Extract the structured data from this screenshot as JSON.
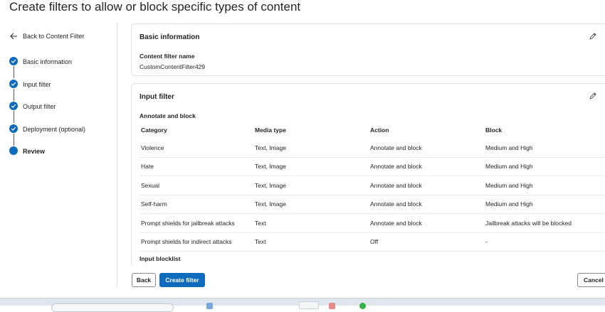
{
  "page": {
    "title": "Create filters to allow or block specific types of content"
  },
  "nav": {
    "back_label": "Back to Content Filter",
    "steps": [
      {
        "label": "Basic information",
        "status": "complete"
      },
      {
        "label": "Input filter",
        "status": "complete"
      },
      {
        "label": "Output filter",
        "status": "complete"
      },
      {
        "label": "Deployment (optional)",
        "status": "complete"
      },
      {
        "label": "Review",
        "status": "current"
      }
    ]
  },
  "basic": {
    "title": "Basic information",
    "field_label": "Content filter name",
    "field_value": "CustomContentFilter429"
  },
  "input_filter": {
    "title": "Input filter",
    "annotate_label": "Annotate and block",
    "columns": [
      "Category",
      "Media type",
      "Action",
      "Block"
    ],
    "rows": [
      [
        "Violence",
        "Text, Image",
        "Annotate and block",
        "Medium and High"
      ],
      [
        "Hate",
        "Text, Image",
        "Annotate and block",
        "Medium and High"
      ],
      [
        "Sexual",
        "Text, Image",
        "Annotate and block",
        "Medium and High"
      ],
      [
        "Self-harm",
        "Text, Image",
        "Annotate and block",
        "Medium and High"
      ],
      [
        "Prompt shields for jailbreak attacks",
        "Text",
        "Annotate and block",
        "Jailbreak attacks will be blocked"
      ],
      [
        "Prompt shields for indirect attacks",
        "Text",
        "Off",
        "-"
      ]
    ],
    "blocklist_label": "Input blocklist"
  },
  "footer": {
    "back_label": "Back",
    "create_label": "Create filter",
    "cancel_label": "Cancel"
  },
  "colors": {
    "accent": "#0f6cbd",
    "border": "#e1dfdd",
    "text": "#242424"
  }
}
